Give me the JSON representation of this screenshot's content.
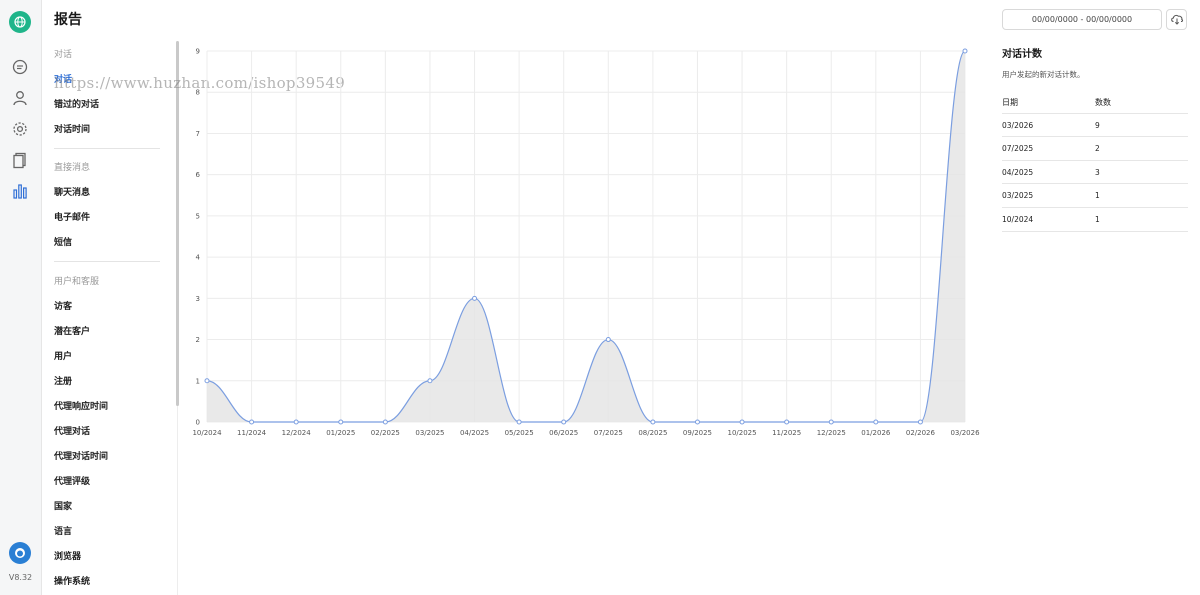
{
  "page": {
    "title": "报告"
  },
  "rail": {
    "icons": [
      "globe-icon",
      "chat-icon",
      "user-icon",
      "gear-icon",
      "documents-icon",
      "chart-icon"
    ],
    "version": "V8.32"
  },
  "header": {
    "date_range": "00/00/0000 - 00/00/0000"
  },
  "nav": {
    "sections": [
      {
        "label": "对话",
        "items": [
          "对话",
          "错过的对话",
          "对话时间"
        ]
      },
      {
        "label": "直接消息",
        "items": [
          "聊天消息",
          "电子邮件",
          "短信"
        ]
      },
      {
        "label": "用户和客服",
        "items": [
          "访客",
          "潜在客户",
          "用户",
          "注册",
          "代理响应时间",
          "代理对话",
          "代理对话时间",
          "代理评级",
          "国家",
          "语言",
          "浏览器",
          "操作系统"
        ]
      }
    ],
    "active_item": "对话"
  },
  "watermark": "https://www.huzhan.com/ishop39549",
  "chart_data": {
    "type": "area",
    "categories": [
      "10/2024",
      "11/2024",
      "12/2024",
      "01/2025",
      "02/2025",
      "03/2025",
      "04/2025",
      "05/2025",
      "06/2025",
      "07/2025",
      "08/2025",
      "09/2025",
      "10/2025",
      "11/2025",
      "12/2025",
      "01/2026",
      "02/2026",
      "03/2026"
    ],
    "values": [
      1,
      0,
      0,
      0,
      0,
      1,
      3,
      0,
      0,
      2,
      0,
      0,
      0,
      0,
      0,
      0,
      0,
      9
    ],
    "y_ticks": [
      "0",
      "1",
      "2",
      "3",
      "4",
      "5",
      "6",
      "7",
      "8",
      "9"
    ],
    "ylim": [
      0,
      9
    ],
    "grid": true,
    "colors": {
      "line": "#7b9ee0",
      "fill": "#e5e5e5",
      "grid": "#ececec"
    }
  },
  "stats": {
    "title": "对话计数",
    "description": "用户发起的新对话计数。",
    "columns": [
      "日期",
      "数数"
    ],
    "rows": [
      [
        "03/2026",
        "9"
      ],
      [
        "07/2025",
        "2"
      ],
      [
        "04/2025",
        "3"
      ],
      [
        "03/2025",
        "1"
      ],
      [
        "10/2024",
        "1"
      ]
    ]
  }
}
